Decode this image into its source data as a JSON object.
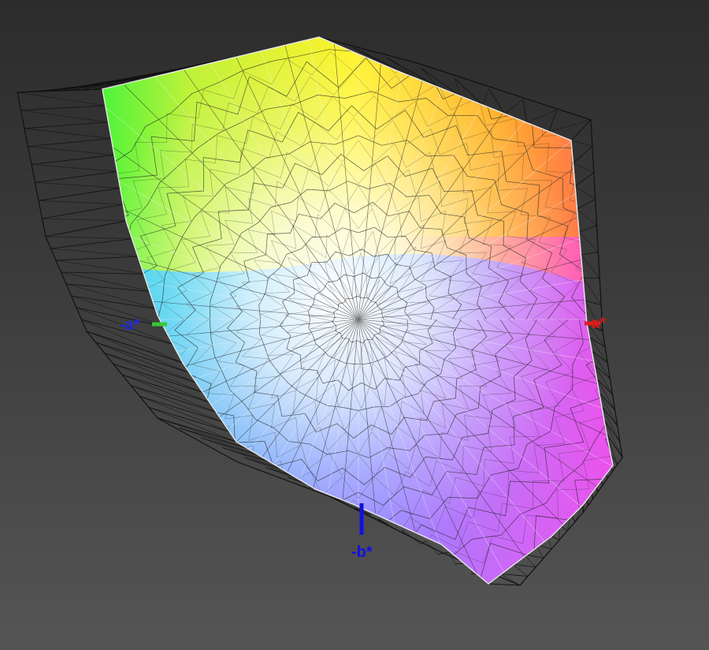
{
  "axes": {
    "neg_a": {
      "label": "-a*",
      "color": "#1f9a1f"
    },
    "pos_a": {
      "label": "a*",
      "color": "#d11a1a"
    },
    "neg_b": {
      "label": "-b*",
      "color": "#1010e0"
    }
  },
  "colors": {
    "background": "#3f3f3f",
    "outer_wire": "#111111",
    "inner_wire": "#f2f2f2",
    "mesh_wire": "#222222"
  }
}
